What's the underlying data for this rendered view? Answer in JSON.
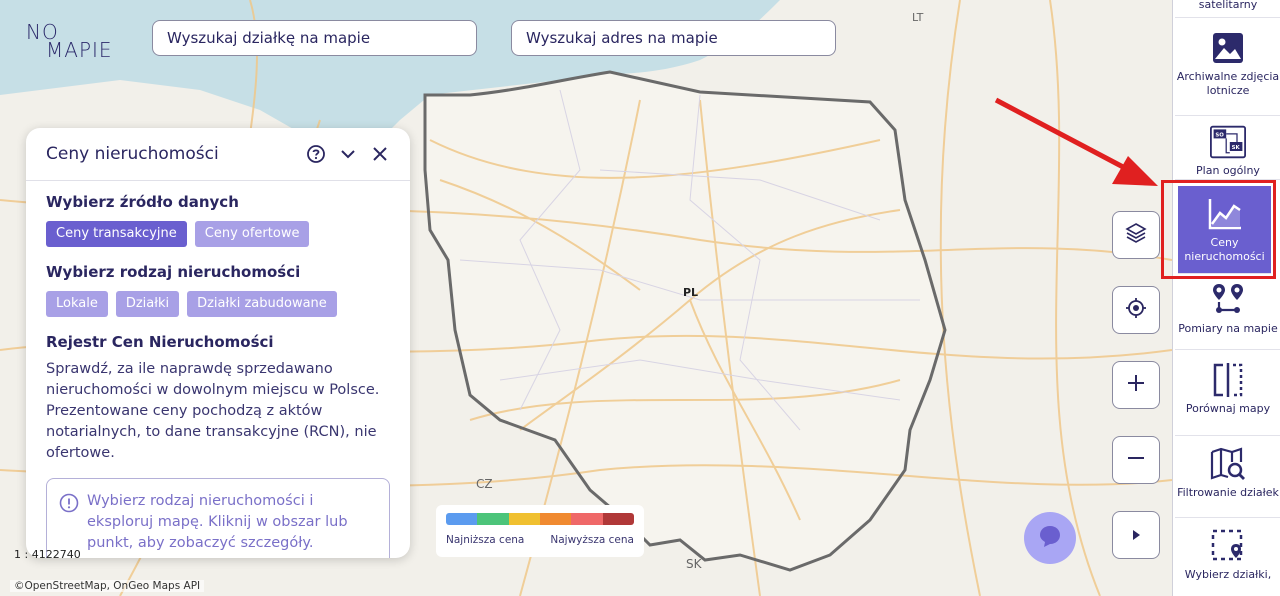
{
  "logo": {
    "line1": "NO",
    "line2": "MAPIE"
  },
  "search": {
    "parcel_placeholder": "Wyszukaj działkę na mapie",
    "address_placeholder": "Wyszukaj adres na mapie"
  },
  "map": {
    "labels": {
      "pl": "PL",
      "cz": "CZ",
      "sk": "SK",
      "lt": "LT"
    }
  },
  "panel": {
    "title": "Ceny nieruchomości",
    "source_title": "Wybierz źródło danych",
    "source_options": [
      "Ceny transakcyjne",
      "Ceny ofertowe"
    ],
    "type_title": "Wybierz rodzaj nieruchomości",
    "type_options": [
      "Lokale",
      "Działki",
      "Działki zabudowane"
    ],
    "registry_title": "Rejestr Cen Nieruchomości",
    "registry_desc": "Sprawdź, za ile naprawdę sprzedawano nieruchomości w dowolnym miejscu w Polsce. Prezentowane ceny pochodzą z aktów notarialnych, to dane transakcyjne (RCN), nie ofertowe.",
    "info_text": "Wybierz rodzaj nieruchomości i eksploruj mapę. Kliknij w obszar lub punkt, aby zobaczyć szczegóły."
  },
  "legend": {
    "low_label": "Najniższa cena",
    "high_label": "Najwyższa cena",
    "colors": [
      "#5b9bef",
      "#4cc47a",
      "#f0c030",
      "#f08a30",
      "#ef6868",
      "#b03838"
    ]
  },
  "scale": "1 : 4122740",
  "attribution": "©OpenStreetMap, OnGeo Maps API",
  "sidebar": {
    "items": [
      {
        "label": "satelitarny",
        "icon": "satellite-icon"
      },
      {
        "label": "Archiwalne zdjęcia lotnicze",
        "icon": "image-icon"
      },
      {
        "label": "Plan ogólny",
        "icon": "plan-icon"
      },
      {
        "label": "Ceny nieruchomości",
        "icon": "chart-line-icon"
      },
      {
        "label": "Pomiary na mapie",
        "icon": "measure-icon"
      },
      {
        "label": "Porównaj mapy",
        "icon": "compare-icon"
      },
      {
        "label": "Filtrowanie działek",
        "icon": "map-search-icon"
      },
      {
        "label": "Wybierz działki,",
        "icon": "select-parcel-icon"
      }
    ]
  },
  "colors": {
    "accent": "#6a5fcf",
    "accent_light": "#a8a0e6",
    "highlight": "#e02020"
  }
}
